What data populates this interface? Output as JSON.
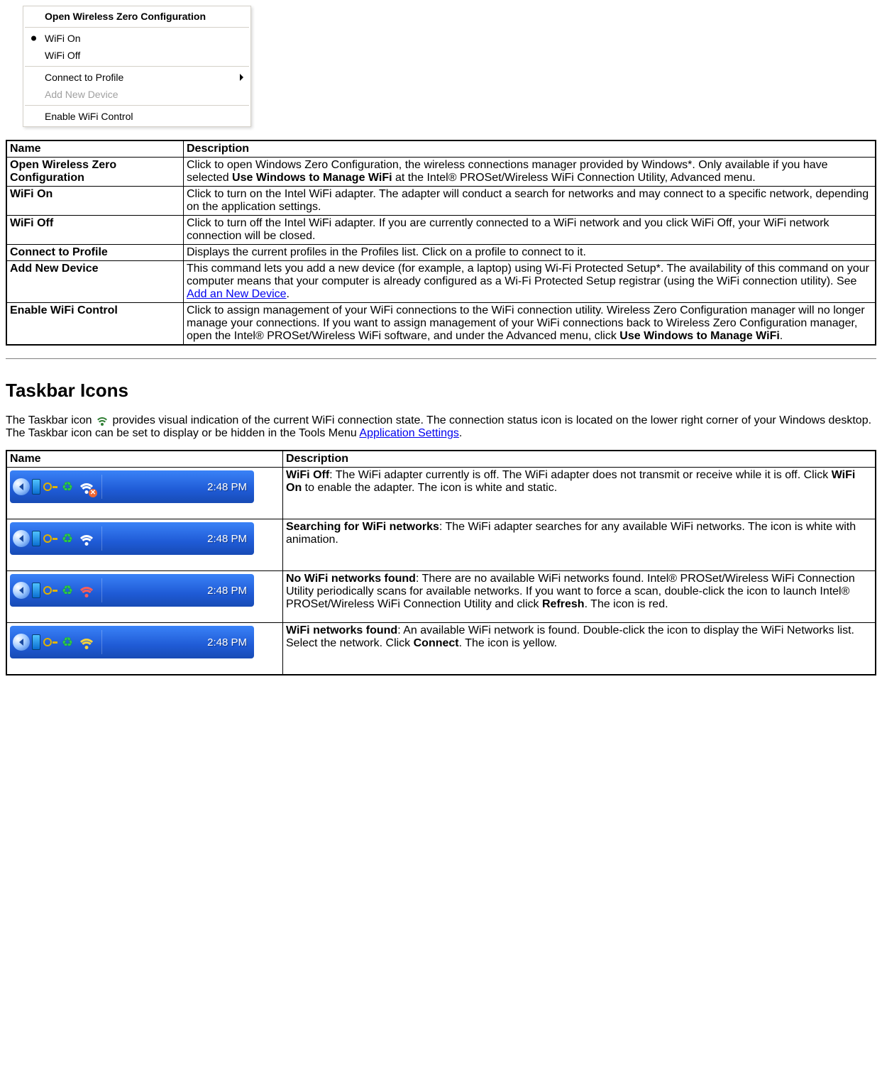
{
  "menu": {
    "items": [
      {
        "label": "Open Wireless Zero Configuration",
        "bold": true
      },
      {
        "sep": true
      },
      {
        "label": "WiFi On",
        "bullet": true
      },
      {
        "label": "WiFi Off"
      },
      {
        "sep": true
      },
      {
        "label": "Connect to Profile",
        "submenu": true
      },
      {
        "label": "Add New Device",
        "disabled": true
      },
      {
        "sep": true
      },
      {
        "label": "Enable WiFi Control"
      }
    ]
  },
  "table1": {
    "headers": {
      "name": "Name",
      "desc": "Description"
    },
    "rows": [
      {
        "name": "Open Wireless Zero Configuration",
        "desc_pre": "Click to open Windows Zero Configuration, the wireless connections manager provided by Windows*. Only available if you have selected ",
        "desc_b1": "Use Windows to Manage WiFi",
        "desc_post": " at the Intel® PROSet/Wireless WiFi Connection Utility, Advanced menu."
      },
      {
        "name": "WiFi On",
        "desc": "Click to turn on the Intel WiFi adapter. The adapter will conduct a search for networks and may connect to a specific network, depending on the application settings."
      },
      {
        "name": "WiFi Off",
        "desc": "Click to turn off the Intel WiFi adapter. If you are currently connected to a WiFi network and you click WiFi Off, your WiFi network connection will be closed."
      },
      {
        "name": "Connect to Profile",
        "desc": "Displays the current profiles in the Profiles list. Click on a profile to connect to it."
      },
      {
        "name": "Add New Device",
        "desc_pre": "This command lets you add a new device (for example, a laptop) using Wi-Fi Protected Setup*. The availability of this command on your computer means that your computer is already configured as a Wi-Fi Protected Setup registrar (using the WiFi connection utility). See ",
        "link": "Add an New Device",
        "desc_post": "."
      },
      {
        "name": "Enable WiFi Control",
        "desc_pre": "Click to assign management of your WiFi connections to the WiFi connection utility. Wireless Zero Configuration manager will no longer manage your connections. If you want to assign management of your WiFi connections back to Wireless Zero Configuration manager, open the Intel® PROSet/Wireless WiFi software, and under the Advanced menu, click ",
        "desc_b1": "Use Windows to Manage WiFi",
        "desc_post": "."
      }
    ]
  },
  "section2": {
    "heading": "Taskbar Icons",
    "para_pre": "The Taskbar icon ",
    "para_mid": " provides visual indication of the current WiFi connection state. The connection status icon is located on the lower right corner of your Windows desktop. The Taskbar icon can be set to display or be hidden in the Tools Menu ",
    "para_link": "Application Settings",
    "para_post": "."
  },
  "table2": {
    "headers": {
      "name": "Name",
      "desc": "Description"
    },
    "time": "2:48 PM",
    "rows": [
      {
        "wifi_variant": "white-x",
        "title": "WiFi Off",
        "text1": ": The WiFi adapter currently is off. The WiFi adapter does not transmit or receive while it is off. Click ",
        "b1": "WiFi On",
        "text2": " to enable the adapter. The icon is white and static."
      },
      {
        "wifi_variant": "white",
        "title": "Searching for WiFi networks",
        "text1": ": The WiFi adapter searches for any available WiFi networks. The icon is white with animation."
      },
      {
        "wifi_variant": "red",
        "title": "No WiFi networks found",
        "text1": ": There are no available WiFi networks found. Intel® PROSet/Wireless WiFi Connection Utility periodically scans for available networks. If you want to force a scan, double-click the icon to launch Intel® PROSet/Wireless WiFi Connection Utility and click ",
        "b1": "Refresh",
        "text2": ". The icon is red."
      },
      {
        "wifi_variant": "yellow",
        "title": "WiFi networks found",
        "text1": ": An available WiFi network is found. Double-click the icon to display the WiFi Networks list. Select the network. Click ",
        "b1": "Connect",
        "text2": ". The icon is yellow."
      }
    ]
  }
}
